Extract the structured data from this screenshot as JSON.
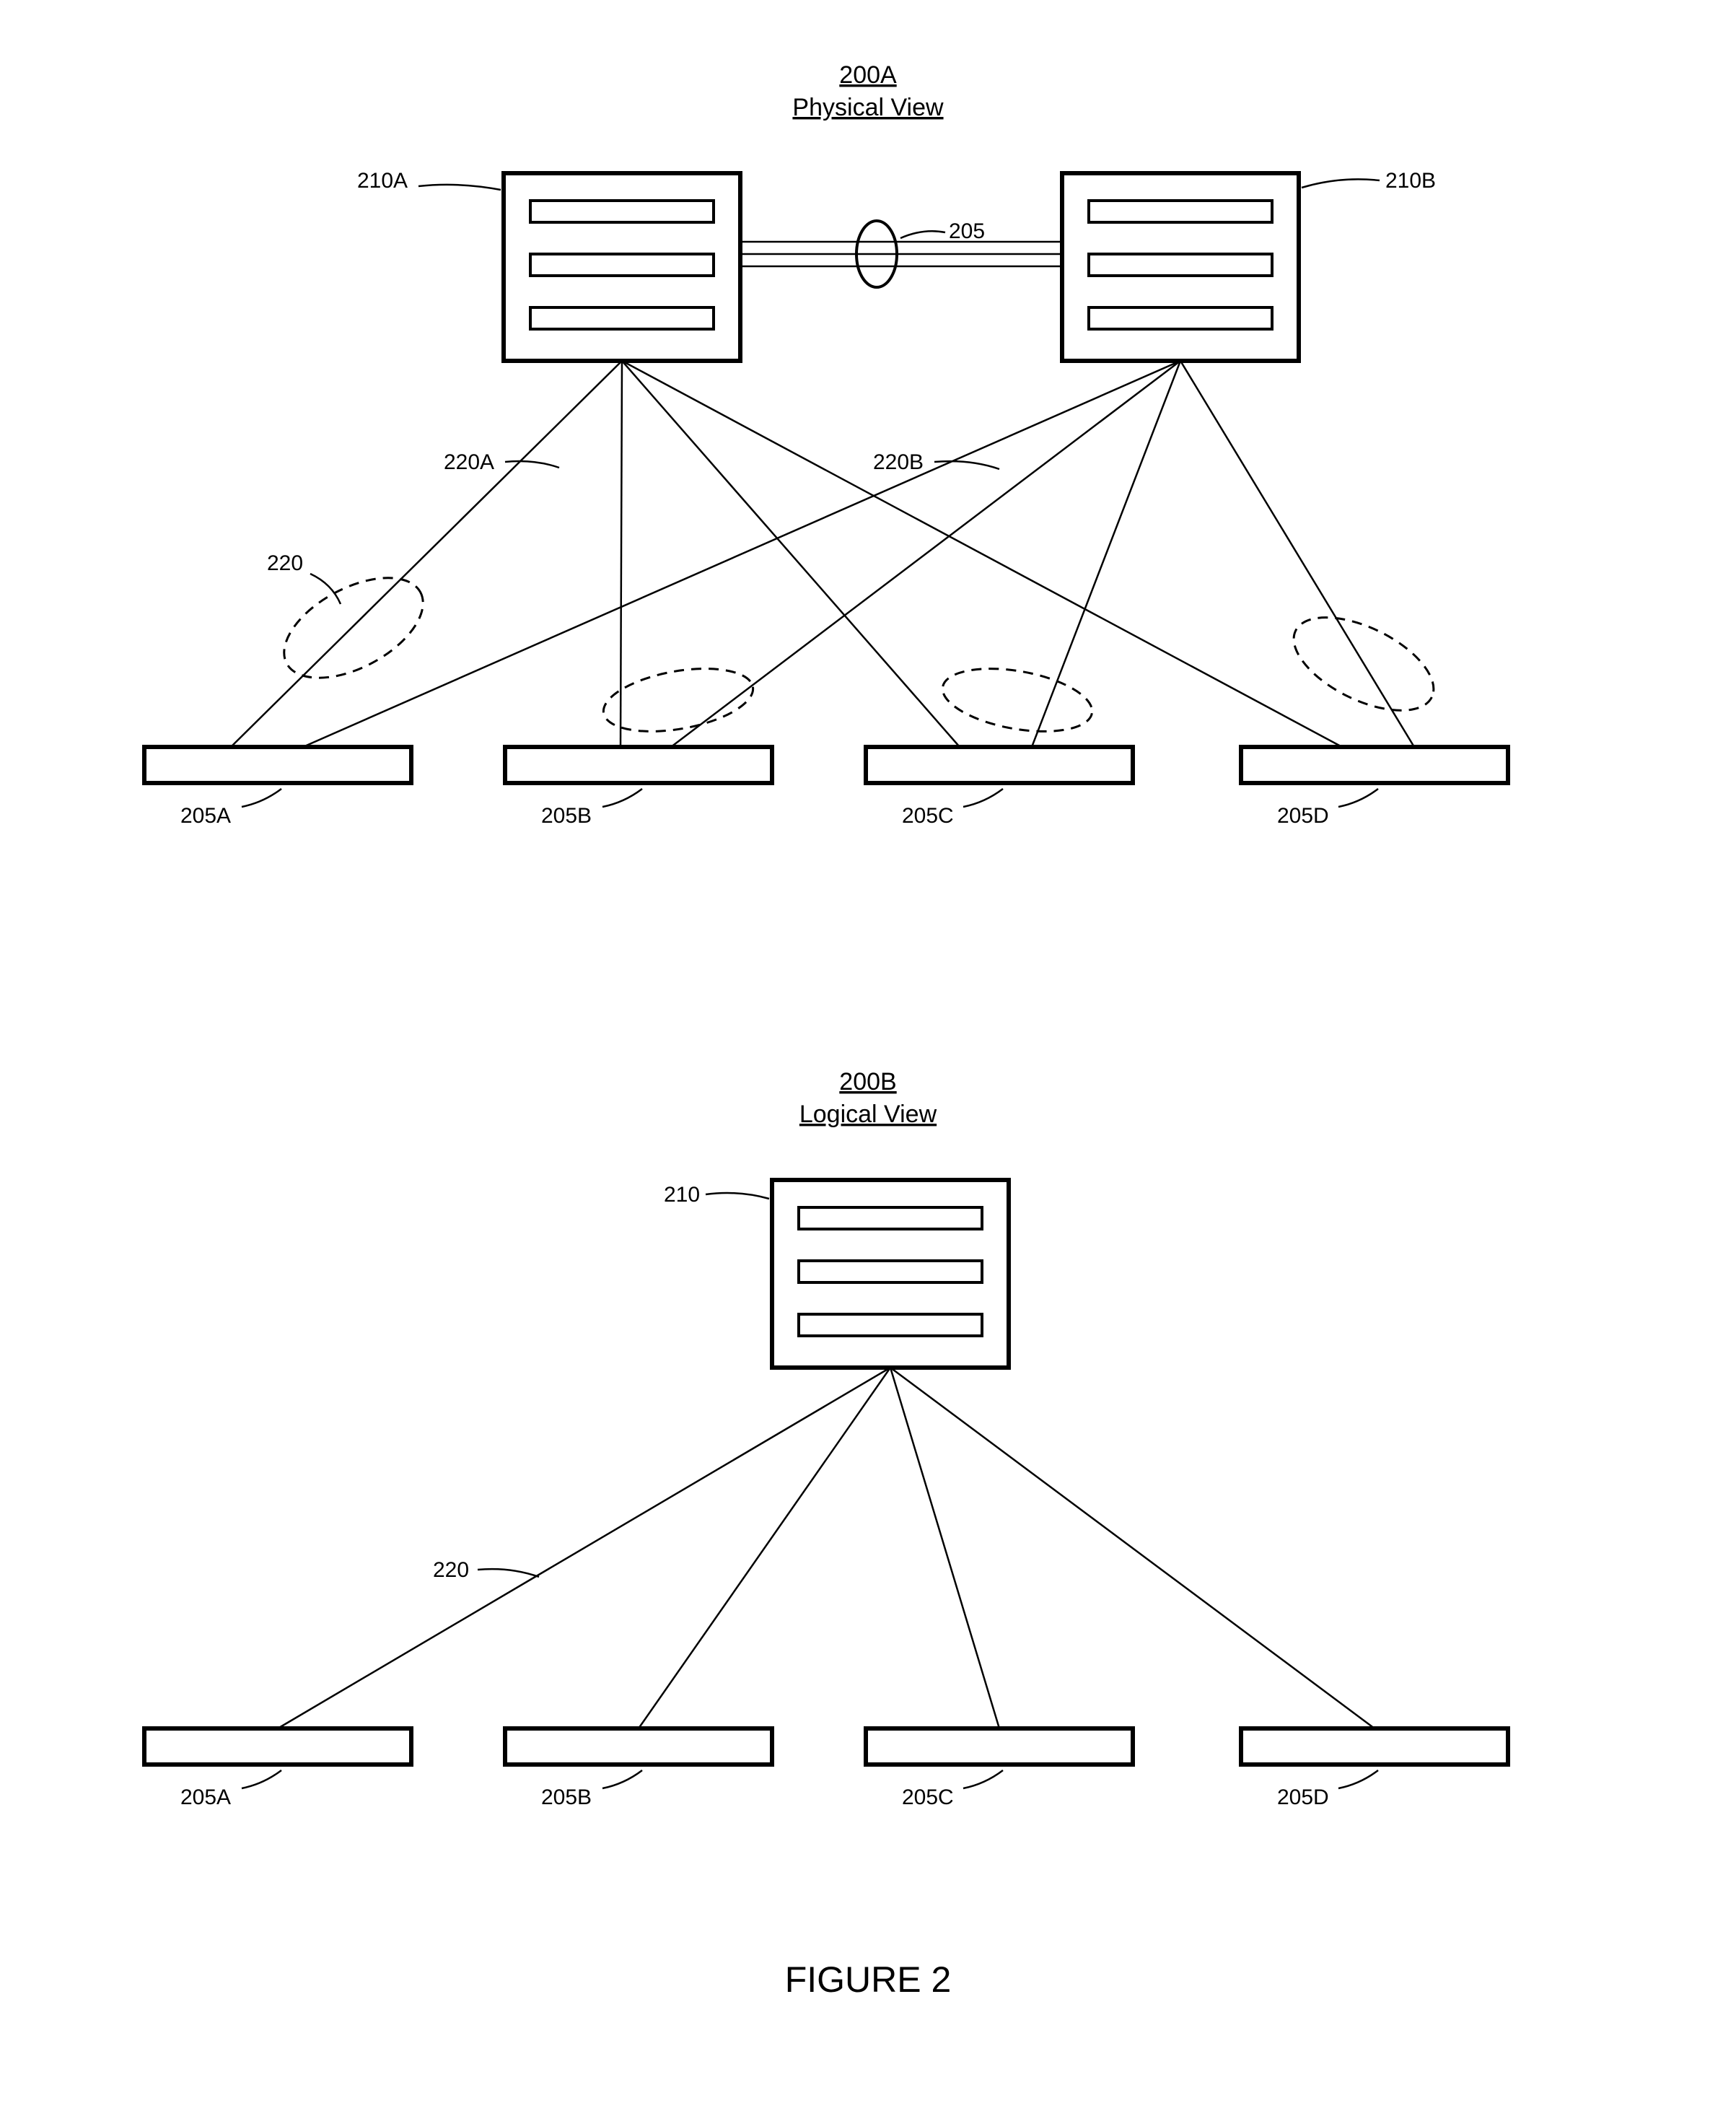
{
  "figure_caption": "FIGURE 2",
  "physical": {
    "id": "200A",
    "title": "Physical View",
    "labels": {
      "switch_left": "210A",
      "switch_right": "210B",
      "peer_link": "205",
      "link_a": "220A",
      "link_b": "220B",
      "lag": "220",
      "node_a": "205A",
      "node_b": "205B",
      "node_c": "205C",
      "node_d": "205D"
    }
  },
  "logical": {
    "id": "200B",
    "title": "Logical View",
    "labels": {
      "switch": "210",
      "link": "220",
      "node_a": "205A",
      "node_b": "205B",
      "node_c": "205C",
      "node_d": "205D"
    }
  }
}
